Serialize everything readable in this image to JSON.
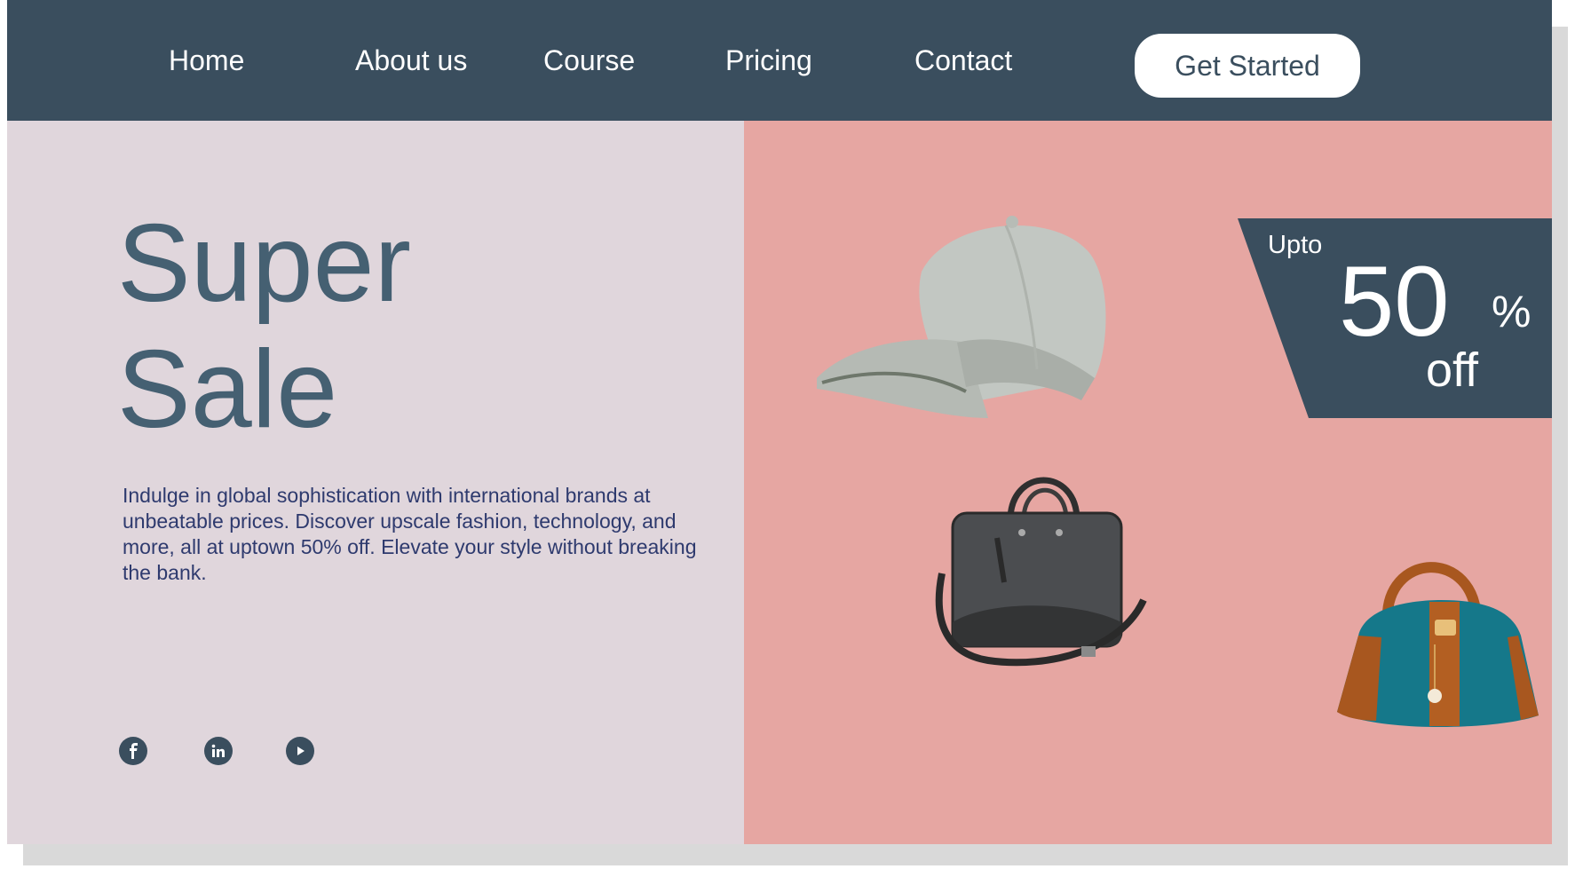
{
  "nav": {
    "links": [
      {
        "label": "Home"
      },
      {
        "label": "About us"
      },
      {
        "label": "Course"
      },
      {
        "label": "Pricing"
      },
      {
        "label": "Contact"
      }
    ],
    "cta_label": "Get Started"
  },
  "hero": {
    "headline_line1": "Super",
    "headline_line2": "Sale",
    "description": "Indulge in global sophistication with international brands at unbeatable prices. Discover upscale fashion, technology, and more, all at uptown 50% off. Elevate your style without breaking the bank."
  },
  "promo": {
    "prefix": "Upto",
    "percent": "50",
    "percent_sign": "%",
    "suffix": "off"
  },
  "social": [
    {
      "icon": "facebook-icon"
    },
    {
      "icon": "linkedin-icon"
    },
    {
      "icon": "youtube-icon"
    }
  ],
  "colors": {
    "nav_bg": "#3a4e5e",
    "left_bg": "#e0d6dc",
    "right_bg": "#e6a6a2",
    "headline": "#456072",
    "body_text": "#2e3a6e"
  }
}
